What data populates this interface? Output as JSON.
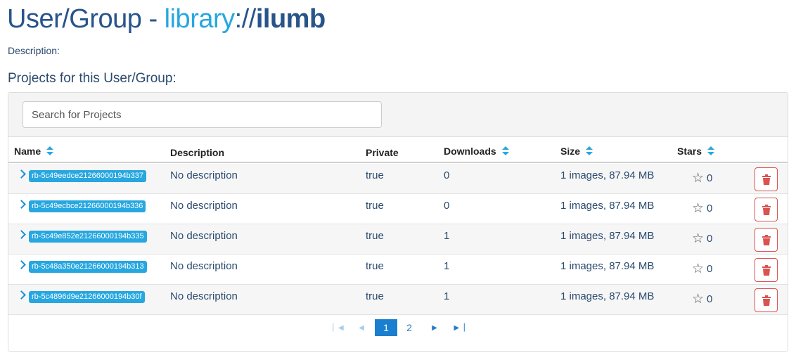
{
  "header": {
    "title_prefix": "User/Group - ",
    "protocol": "library",
    "separator": "://",
    "entity_name": "ilumb",
    "description_label": "Description:"
  },
  "projects": {
    "section_title": "Projects for this User/Group:",
    "search": {
      "placeholder": "Search for Projects",
      "value": ""
    },
    "columns": {
      "name": "Name",
      "description": "Description",
      "private": "Private",
      "downloads": "Downloads",
      "size": "Size",
      "stars": "Stars"
    },
    "rows": [
      {
        "name": "rb-5c49eedce21266000194b337",
        "description": "No description",
        "private": "true",
        "downloads": "0",
        "size": "1 images, 87.94 MB",
        "stars": "0"
      },
      {
        "name": "rb-5c49ecbce21266000194b336",
        "description": "No description",
        "private": "true",
        "downloads": "0",
        "size": "1 images, 87.94 MB",
        "stars": "0"
      },
      {
        "name": "rb-5c49e852e21266000194b335",
        "description": "No description",
        "private": "true",
        "downloads": "1",
        "size": "1 images, 87.94 MB",
        "stars": "0"
      },
      {
        "name": "rb-5c48a350e21266000194b313",
        "description": "No description",
        "private": "true",
        "downloads": "1",
        "size": "1 images, 87.94 MB",
        "stars": "0"
      },
      {
        "name": "rb-5c4896d9e21266000194b30f",
        "description": "No description",
        "private": "true",
        "downloads": "1",
        "size": "1 images, 87.94 MB",
        "stars": "0"
      }
    ],
    "pagination": {
      "first_icon": "first-page-icon",
      "prev_icon": "prev-page-icon",
      "pages": [
        "1",
        "2"
      ],
      "current": "1",
      "next_icon": "next-page-icon",
      "last_icon": "last-page-icon"
    }
  },
  "colors": {
    "title": "#28548a",
    "accent": "#27a7e0",
    "delete": "#d9534f",
    "pager_active": "#1a7fcf"
  }
}
